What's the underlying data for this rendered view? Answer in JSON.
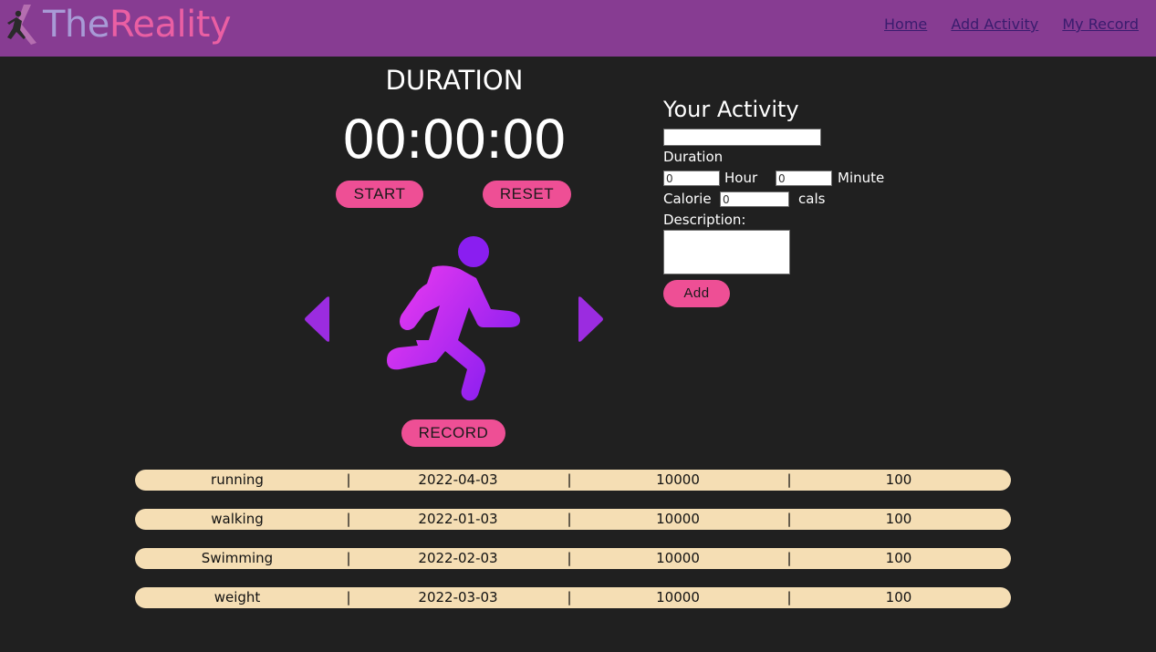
{
  "nav": {
    "logo_text_a": "The",
    "logo_text_b": "Reality",
    "links": [
      "Home",
      "Add Activity",
      "My Record"
    ]
  },
  "timer": {
    "title": "DURATION",
    "display": "00:00:00",
    "start_label": "START",
    "reset_label": "RESET",
    "record_label": "RECORD"
  },
  "form": {
    "title": "Your Activity",
    "activity_value": "",
    "duration_label": "Duration",
    "hour_value": "0",
    "hour_label": "Hour",
    "minute_value": "0",
    "minute_label": "Minute",
    "calorie_label": "Calorie",
    "calorie_value": "0",
    "calorie_unit": "cals",
    "description_label": "Description:",
    "add_label": "Add"
  },
  "records": [
    {
      "name": "running",
      "date": "2022-04-03",
      "steps": "10000",
      "value": "100"
    },
    {
      "name": "walking",
      "date": "2022-01-03",
      "steps": "10000",
      "value": "100"
    },
    {
      "name": "Swimming",
      "date": "2022-02-03",
      "steps": "10000",
      "value": "100"
    },
    {
      "name": "weight",
      "date": "2022-03-03",
      "steps": "10000",
      "value": "100"
    }
  ],
  "record_separator": "|",
  "colors": {
    "background": "#202020",
    "navbar": "#873c92",
    "accent_pink": "#ee4f95",
    "accent_purple": "#9b2ce0",
    "row_bg": "#f5deb4"
  },
  "icons": {
    "logo": "runner-logo-icon",
    "prev": "triangle-left-icon",
    "next": "triangle-right-icon",
    "activity": "running-person-icon"
  }
}
